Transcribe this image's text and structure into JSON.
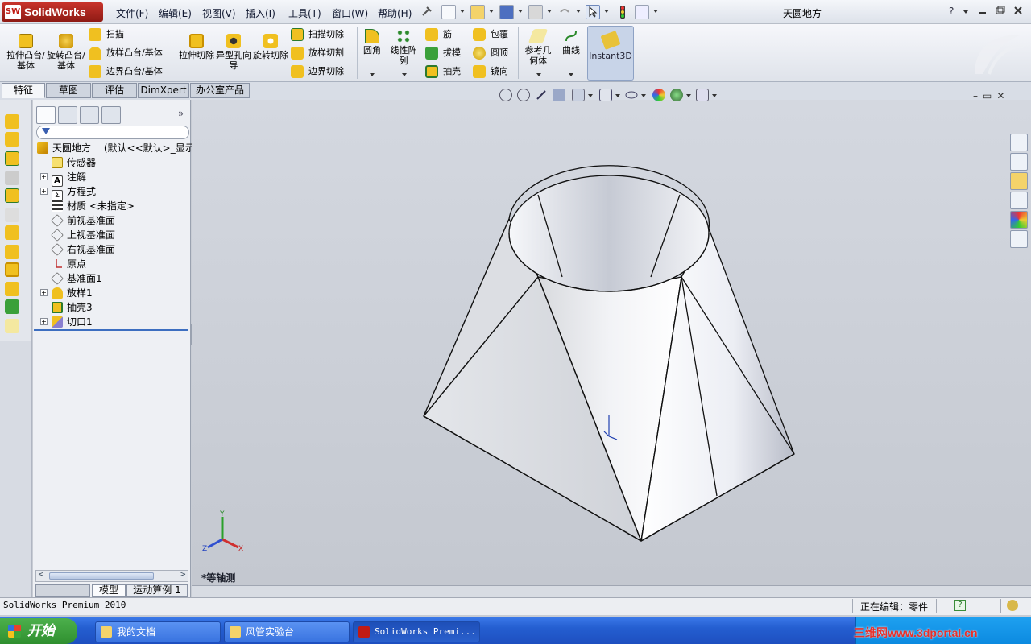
{
  "app": {
    "logo_text": "SolidWorks",
    "title": "天圆地方",
    "menus": [
      "文件(F)",
      "编辑(E)",
      "视图(V)",
      "插入(I)",
      "工具(T)",
      "窗口(W)",
      "帮助(H)"
    ],
    "help_symbol": "?"
  },
  "ribbon": {
    "extrude_boss": "拉伸凸台/基体",
    "revolve_boss": "旋转凸台/基体",
    "sweep": "扫描",
    "loft_boss": "放样凸台/基体",
    "boundary_boss": "边界凸台/基体",
    "extrude_cut": "拉伸切除",
    "hole_wizard": "异型孔向导",
    "revolve_cut": "旋转切除",
    "swept_cut": "扫描切除",
    "lofted_cut": "放样切割",
    "boundary_cut": "边界切除",
    "fillet": "圆角",
    "linear_pattern": "线性阵列",
    "rib": "筋",
    "draft": "拔模",
    "shell": "抽壳",
    "wrap": "包覆",
    "dome": "圆顶",
    "mirror": "镜向",
    "ref_geometry": "参考几何体",
    "curves": "曲线",
    "instant3d": "Instant3D"
  },
  "tabs": [
    "特征",
    "草图",
    "评估",
    "DimXpert",
    "办公室产品"
  ],
  "feature_tree": {
    "root": "天圆地方",
    "root_config": "(默认<<默认>_显示状",
    "items": [
      {
        "label": "传感器",
        "expandable": false,
        "icon": "sensor-icon"
      },
      {
        "label": "注解",
        "expandable": true,
        "icon": "annotation-icon"
      },
      {
        "label": "方程式",
        "expandable": true,
        "icon": "equation-icon"
      },
      {
        "label": "材质 <未指定>",
        "expandable": false,
        "icon": "material-icon"
      },
      {
        "label": "前视基准面",
        "expandable": false,
        "icon": "plane-icon"
      },
      {
        "label": "上视基准面",
        "expandable": false,
        "icon": "plane-icon"
      },
      {
        "label": "右视基准面",
        "expandable": false,
        "icon": "plane-icon"
      },
      {
        "label": "原点",
        "expandable": false,
        "icon": "origin-icon"
      },
      {
        "label": "基准面1",
        "expandable": false,
        "icon": "plane-icon"
      },
      {
        "label": "放样1",
        "expandable": true,
        "icon": "loft-icon"
      },
      {
        "label": "抽壳3",
        "expandable": false,
        "icon": "shell-icon"
      },
      {
        "label": "切口1",
        "expandable": true,
        "icon": "rip-icon"
      }
    ]
  },
  "bottom_tabs": [
    "模型",
    "运动算例 1"
  ],
  "viewport": {
    "view_label": "*等轴测",
    "axis_x": "X",
    "axis_y": "Y",
    "axis_z": "Z"
  },
  "status": {
    "product": "SolidWorks Premium 2010",
    "editing": "正在编辑：零件"
  },
  "taskbar": {
    "start": "开始",
    "tasks": [
      "我的文档",
      "风管实验台",
      "SolidWorks Premi..."
    ],
    "watermark": "三维网www.3dportal.cn"
  },
  "colors": {
    "accent": "#c01b14",
    "feature_icon_yellow": "#f0c020",
    "viewport_bg": "#c8ccd4",
    "taskbar_blue": "#245ed0"
  }
}
